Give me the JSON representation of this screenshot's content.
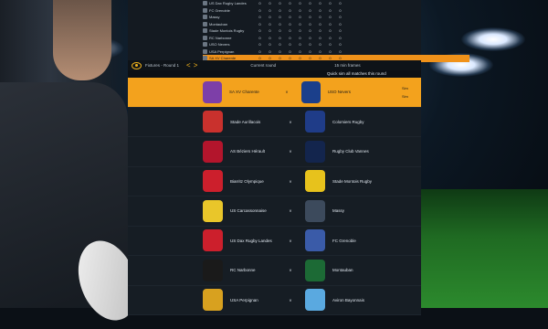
{
  "standings": [
    {
      "name": "US Dax Rugby Landes",
      "stats": [
        0,
        0,
        0,
        0,
        0,
        0,
        0,
        0,
        0
      ],
      "highlight": false
    },
    {
      "name": "FC Grenoble",
      "stats": [
        0,
        0,
        0,
        0,
        0,
        0,
        0,
        0,
        0
      ],
      "highlight": false
    },
    {
      "name": "Massy",
      "stats": [
        0,
        0,
        0,
        0,
        0,
        0,
        0,
        0,
        0
      ],
      "highlight": false
    },
    {
      "name": "Montauban",
      "stats": [
        0,
        0,
        0,
        0,
        0,
        0,
        0,
        0,
        0
      ],
      "highlight": false
    },
    {
      "name": "Stade Montois Rugby",
      "stats": [
        0,
        0,
        0,
        0,
        0,
        0,
        0,
        0,
        0
      ],
      "highlight": false
    },
    {
      "name": "RC Narbonne",
      "stats": [
        0,
        0,
        0,
        0,
        0,
        0,
        0,
        0,
        0
      ],
      "highlight": false
    },
    {
      "name": "USO Nevers",
      "stats": [
        0,
        0,
        0,
        0,
        0,
        0,
        0,
        0,
        0
      ],
      "highlight": false
    },
    {
      "name": "USA Perpignan",
      "stats": [
        0,
        0,
        0,
        0,
        0,
        0,
        0,
        0,
        0
      ],
      "highlight": false
    },
    {
      "name": "SA XV Charente",
      "stats": [
        0,
        0,
        0,
        0,
        0,
        0,
        0,
        0,
        0
      ],
      "highlight": true
    },
    {
      "name": "Rugby Club Vannes",
      "stats": [
        0,
        0,
        0,
        0,
        0,
        0,
        0,
        0,
        0
      ],
      "highlight": false
    }
  ],
  "round": {
    "label": "Fixtures - Round 1",
    "prev": "<",
    "next": ">",
    "current": "Current round",
    "last": "15 min frames"
  },
  "quick_sim": "Quick sim all matches this round",
  "matches": [
    {
      "home": "SA XV Charente",
      "away": "USO Nevers",
      "home_color": "#7d3fa8",
      "away_color": "#1b3f8b",
      "active": true,
      "score": "Sim",
      "score2": "Sim"
    },
    {
      "home": "Stade Aurillacois",
      "away": "Colomiers Rugby",
      "home_color": "#c9312d",
      "away_color": "#1f3c88",
      "active": false
    },
    {
      "home": "AS Béziers Hérault",
      "away": "Rugby Club Vannes",
      "home_color": "#b3152c",
      "away_color": "#13254d",
      "active": false
    },
    {
      "home": "Biarritz Olympique",
      "away": "Stade Montois Rugby",
      "home_color": "#cc1f2c",
      "away_color": "#e7c21c",
      "active": false
    },
    {
      "home": "US Carcassonnaise",
      "away": "Massy",
      "home_color": "#e9c62a",
      "away_color": "#3c4a5c",
      "active": false
    },
    {
      "home": "US Dax Rugby Landes",
      "away": "FC Grenoble",
      "home_color": "#cc1f2c",
      "away_color": "#3a5ba8",
      "active": false
    },
    {
      "home": "RC Narbonne",
      "away": "Montauban",
      "home_color": "#1a1a1a",
      "away_color": "#1c6a35",
      "active": false
    },
    {
      "home": "USA Perpignan",
      "away": "Aviron Bayonnais",
      "home_color": "#d8a11f",
      "away_color": "#5aa9e0",
      "active": false
    }
  ],
  "vs": "v"
}
